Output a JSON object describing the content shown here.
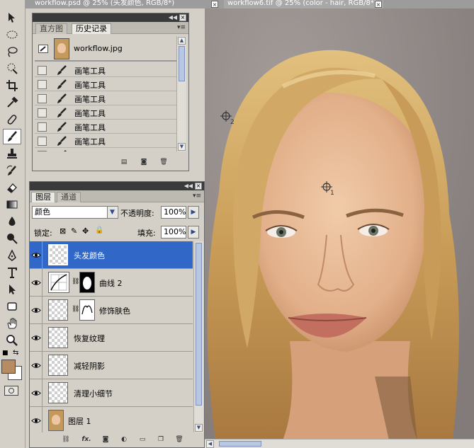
{
  "documents": [
    {
      "title": "workflow.psd @ 25% (头发颜色, RGB/8*)",
      "close": "×"
    },
    {
      "title": "workflow6.tif @ 25% (color - hair, RGB/8*)",
      "close": "×"
    }
  ],
  "history_panel": {
    "tabs": [
      "直方图",
      "历史记录"
    ],
    "active_tab": "历史记录",
    "snapshot": {
      "label": "workflow.jpg"
    },
    "items": [
      "画笔工具",
      "画笔工具",
      "画笔工具",
      "画笔工具",
      "画笔工具",
      "画笔工具",
      "画笔工具"
    ]
  },
  "layers_panel": {
    "tabs": [
      "图层",
      "通道"
    ],
    "active_tab": "图层",
    "blend_mode": "颜色",
    "opacity_label": "不透明度:",
    "opacity_value": "100%",
    "lock_label": "锁定:",
    "fill_label": "填充:",
    "fill_value": "100%",
    "layers": [
      {
        "name": "头发颜色",
        "selected": true,
        "type": "pixel"
      },
      {
        "name": "曲线 2",
        "selected": false,
        "type": "adjustment"
      },
      {
        "name": "修饰肤色",
        "selected": false,
        "type": "masked"
      },
      {
        "name": "恢复纹理",
        "selected": false,
        "type": "pixel"
      },
      {
        "name": "减轻阴影",
        "selected": false,
        "type": "pixel"
      },
      {
        "name": "清理小细节",
        "selected": false,
        "type": "pixel"
      },
      {
        "name": "图层 1",
        "selected": false,
        "type": "photo"
      }
    ],
    "footer_icons": [
      "link-icon",
      "fx-icon",
      "add-mask-icon",
      "adjustment-layer-icon",
      "new-group-icon",
      "new-layer-icon",
      "trash-icon"
    ],
    "footer_fx": "fx."
  },
  "canvas": {
    "markers": [
      {
        "label": "2"
      },
      {
        "label": "1"
      }
    ]
  },
  "colors": {
    "foreground": "#b88c63",
    "background": "#ffffff",
    "selected_layer": "#3168c8"
  }
}
